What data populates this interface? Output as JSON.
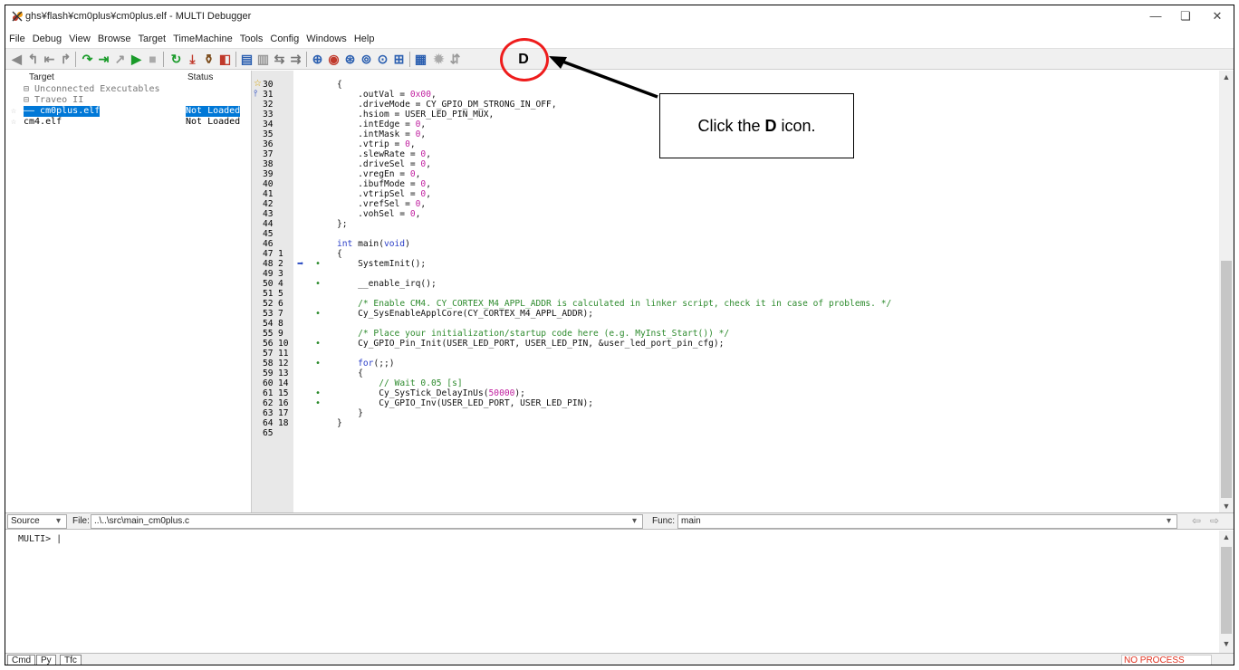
{
  "window": {
    "title": "ghs¥flash¥cm0plus¥cm0plus.elf - MULTI Debugger",
    "minimize_glyph": "—",
    "restore_glyph": "❏",
    "close_glyph": "✕"
  },
  "menu": [
    "File",
    "Debug",
    "View",
    "Browse",
    "Target",
    "TimeMachine",
    "Tools",
    "Config",
    "Windows",
    "Help"
  ],
  "toolbar": {
    "d_button_label": "D"
  },
  "targets": {
    "header_target": "Target",
    "header_status": "Status",
    "rows": [
      {
        "name": "⊟ Unconnected Executables",
        "status": ""
      },
      {
        "name": "  ⊟ Traveo II",
        "status": ""
      },
      {
        "name": "    —— cm0plus.elf",
        "status": "Not Loaded"
      },
      {
        "name": "       cm4.elf",
        "status": "Not Loaded"
      }
    ]
  },
  "code_lines": [
    {
      "n": "30",
      "n2": "",
      "dot": false,
      "html": "{"
    },
    {
      "n": "31",
      "n2": "",
      "dot": false,
      "html": "    .outVal = <span class='nm'>0x00</span>,"
    },
    {
      "n": "32",
      "n2": "",
      "dot": false,
      "html": "    .driveMode = CY_GPIO_DM_STRONG_IN_OFF,"
    },
    {
      "n": "33",
      "n2": "",
      "dot": false,
      "html": "    .hsiom = USER_LED_PIN_MUX,"
    },
    {
      "n": "34",
      "n2": "",
      "dot": false,
      "html": "    .intEdge = <span class='nm'>0</span>,"
    },
    {
      "n": "35",
      "n2": "",
      "dot": false,
      "html": "    .intMask = <span class='nm'>0</span>,"
    },
    {
      "n": "36",
      "n2": "",
      "dot": false,
      "html": "    .vtrip = <span class='nm'>0</span>,"
    },
    {
      "n": "37",
      "n2": "",
      "dot": false,
      "html": "    .slewRate = <span class='nm'>0</span>,"
    },
    {
      "n": "38",
      "n2": "",
      "dot": false,
      "html": "    .driveSel = <span class='nm'>0</span>,"
    },
    {
      "n": "39",
      "n2": "",
      "dot": false,
      "html": "    .vregEn = <span class='nm'>0</span>,"
    },
    {
      "n": "40",
      "n2": "",
      "dot": false,
      "html": "    .ibufMode = <span class='nm'>0</span>,"
    },
    {
      "n": "41",
      "n2": "",
      "dot": false,
      "html": "    .vtripSel = <span class='nm'>0</span>,"
    },
    {
      "n": "42",
      "n2": "",
      "dot": false,
      "html": "    .vrefSel = <span class='nm'>0</span>,"
    },
    {
      "n": "43",
      "n2": "",
      "dot": false,
      "html": "    .vohSel = <span class='nm'>0</span>,"
    },
    {
      "n": "44",
      "n2": "",
      "dot": false,
      "html": "};"
    },
    {
      "n": "45",
      "n2": "",
      "dot": false,
      "html": ""
    },
    {
      "n": "46",
      "n2": "",
      "dot": false,
      "html": "<span class='kw'>int</span> main(<span class='kw'>void</span>)"
    },
    {
      "n": "47",
      "n2": "1",
      "dot": false,
      "html": "{"
    },
    {
      "n": "48",
      "n2": "2",
      "dot": true,
      "arrow": true,
      "html": "    SystemInit();"
    },
    {
      "n": "49",
      "n2": "3",
      "dot": false,
      "html": ""
    },
    {
      "n": "50",
      "n2": "4",
      "dot": true,
      "html": "    __enable_irq();"
    },
    {
      "n": "51",
      "n2": "5",
      "dot": false,
      "html": ""
    },
    {
      "n": "52",
      "n2": "6",
      "dot": false,
      "html": "    <span class='cm'>/* Enable CM4. CY_CORTEX_M4_APPL_ADDR is calculated in linker script, check it in case of problems. */</span>"
    },
    {
      "n": "53",
      "n2": "7",
      "dot": true,
      "html": "    Cy_SysEnableApplCore(CY_CORTEX_M4_APPL_ADDR);"
    },
    {
      "n": "54",
      "n2": "8",
      "dot": false,
      "html": ""
    },
    {
      "n": "55",
      "n2": "9",
      "dot": false,
      "html": "    <span class='cm'>/* Place your initialization/startup code here (e.g. MyInst_Start()) */</span>"
    },
    {
      "n": "56",
      "n2": "10",
      "dot": true,
      "html": "    Cy_GPIO_Pin_Init(USER_LED_PORT, USER_LED_PIN, &amp;user_led_port_pin_cfg);"
    },
    {
      "n": "57",
      "n2": "11",
      "dot": false,
      "html": ""
    },
    {
      "n": "58",
      "n2": "12",
      "dot": true,
      "html": "    <span class='kw'>for</span>(;;)"
    },
    {
      "n": "59",
      "n2": "13",
      "dot": false,
      "html": "    {"
    },
    {
      "n": "60",
      "n2": "14",
      "dot": false,
      "html": "        <span class='cm'>// Wait 0.05 [s]</span>"
    },
    {
      "n": "61",
      "n2": "15",
      "dot": true,
      "html": "        Cy_SysTick_DelayInUs(<span class='nm'>50000</span>);"
    },
    {
      "n": "62",
      "n2": "16",
      "dot": true,
      "html": "        Cy_GPIO_Inv(USER_LED_PORT, USER_LED_PIN);"
    },
    {
      "n": "63",
      "n2": "17",
      "dot": false,
      "html": "    }"
    },
    {
      "n": "64",
      "n2": "18",
      "dot": false,
      "html": "}"
    },
    {
      "n": "65",
      "n2": "",
      "dot": false,
      "html": ""
    }
  ],
  "source_bar": {
    "mode": "Source",
    "file_label": "File:",
    "file_value": "..\\..\\src\\main_cm0plus.c",
    "func_label": "Func:",
    "func_value": "main"
  },
  "command": {
    "prompt": "MULTI> |"
  },
  "status_tabs": [
    "Cmd",
    "Py",
    "Tfc"
  ],
  "status": {
    "process": "NO PROCESS"
  },
  "annotation": {
    "prefix": "Click the ",
    "bold": "D",
    "suffix": " icon."
  },
  "colors": {
    "highlight": "#0078d7",
    "annotation_ring": "#ee1c1c",
    "no_process": "#e0301e"
  }
}
